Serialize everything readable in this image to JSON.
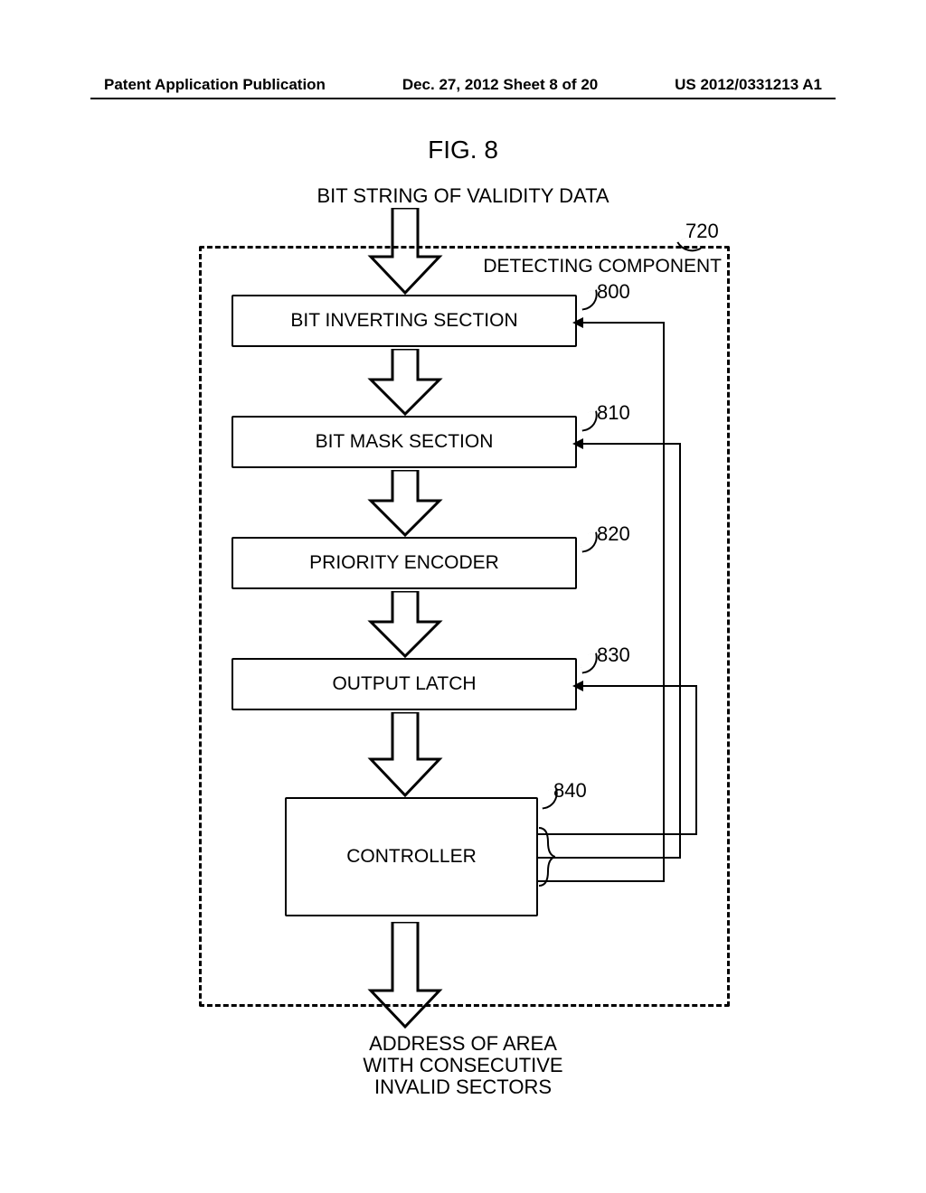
{
  "header": {
    "left": "Patent Application Publication",
    "center": "Dec. 27, 2012  Sheet 8 of 20",
    "right": "US 2012/0331213 A1"
  },
  "figure_title": "FIG. 8",
  "input_label": "BIT STRING OF VALIDITY DATA",
  "output_label_line1": "ADDRESS OF AREA",
  "output_label_line2": "WITH CONSECUTIVE",
  "output_label_line3": "INVALID SECTORS",
  "container_label": "DETECTING COMPONENT",
  "blocks": {
    "b800": {
      "label": "BIT INVERTING SECTION",
      "ref": "800"
    },
    "b810": {
      "label": "BIT MASK SECTION",
      "ref": "810"
    },
    "b820": {
      "label": "PRIORITY ENCODER",
      "ref": "820"
    },
    "b830": {
      "label": "OUTPUT LATCH",
      "ref": "830"
    },
    "b840": {
      "label": "CONTROLLER",
      "ref": "840"
    }
  },
  "container_ref": "720"
}
